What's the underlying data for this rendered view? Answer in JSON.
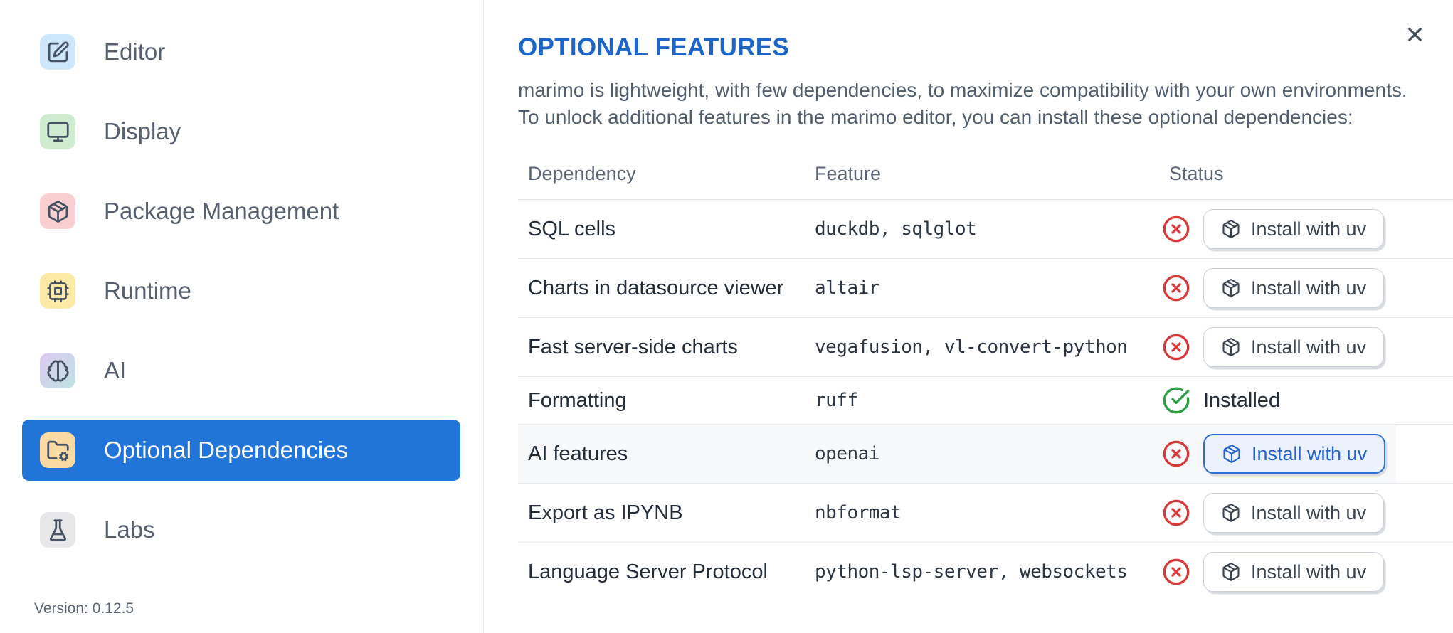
{
  "sidebar": {
    "items": [
      {
        "label": "Editor",
        "icon": "square-pen-icon",
        "icon_bg": "#cde6fa"
      },
      {
        "label": "Display",
        "icon": "monitor-icon",
        "icon_bg": "#d0ecd0"
      },
      {
        "label": "Package Management",
        "icon": "package-icon",
        "icon_bg": "#f9cfd2"
      },
      {
        "label": "Runtime",
        "icon": "cpu-icon",
        "icon_bg": "#fbe9a6"
      },
      {
        "label": "AI",
        "icon": "brain-icon",
        "icon_bg": "linear-gradient(135deg,#dccaf0 0%,#bfe2e3 100%)"
      },
      {
        "label": "Optional Dependencies",
        "icon": "folder-cog-icon",
        "icon_bg": "#fbd9a2",
        "selected": true
      },
      {
        "label": "Labs",
        "icon": "flask-icon",
        "icon_bg": "#e7e7ea"
      }
    ],
    "version": "Version: 0.12.5"
  },
  "panel": {
    "title": "OPTIONAL FEATURES",
    "description": [
      "marimo is lightweight, with few dependencies, to maximize compatibility with your own environments.",
      "To unlock additional features in the marimo editor, you can install these optional dependencies:"
    ]
  },
  "table": {
    "headers": {
      "dependency": "Dependency",
      "feature": "Feature",
      "status": "Status"
    },
    "install_button_label": "Install with uv",
    "installed_label": "Installed",
    "rows": [
      {
        "dependency": "SQL cells",
        "feature": "duckdb, sqlglot",
        "installed": false
      },
      {
        "dependency": "Charts in datasource viewer",
        "feature": "altair",
        "installed": false
      },
      {
        "dependency": "Fast server-side charts",
        "feature": "vegafusion, vl-convert-python",
        "installed": false
      },
      {
        "dependency": "Formatting",
        "feature": "ruff",
        "installed": true
      },
      {
        "dependency": "AI features",
        "feature": "openai",
        "installed": false,
        "focused": true
      },
      {
        "dependency": "Export as IPYNB",
        "feature": "nbformat",
        "installed": false
      },
      {
        "dependency": "Language Server Protocol",
        "feature": "python-lsp-server, websockets",
        "installed": false
      }
    ]
  },
  "colors": {
    "accent_blue": "#2174d8",
    "title_blue": "#1d66c9",
    "focus_blue": "#2f6fd3",
    "error_red": "#d63a3a",
    "success_green": "#2f9e44",
    "highlight_row_bg": "#f7f8f9"
  }
}
